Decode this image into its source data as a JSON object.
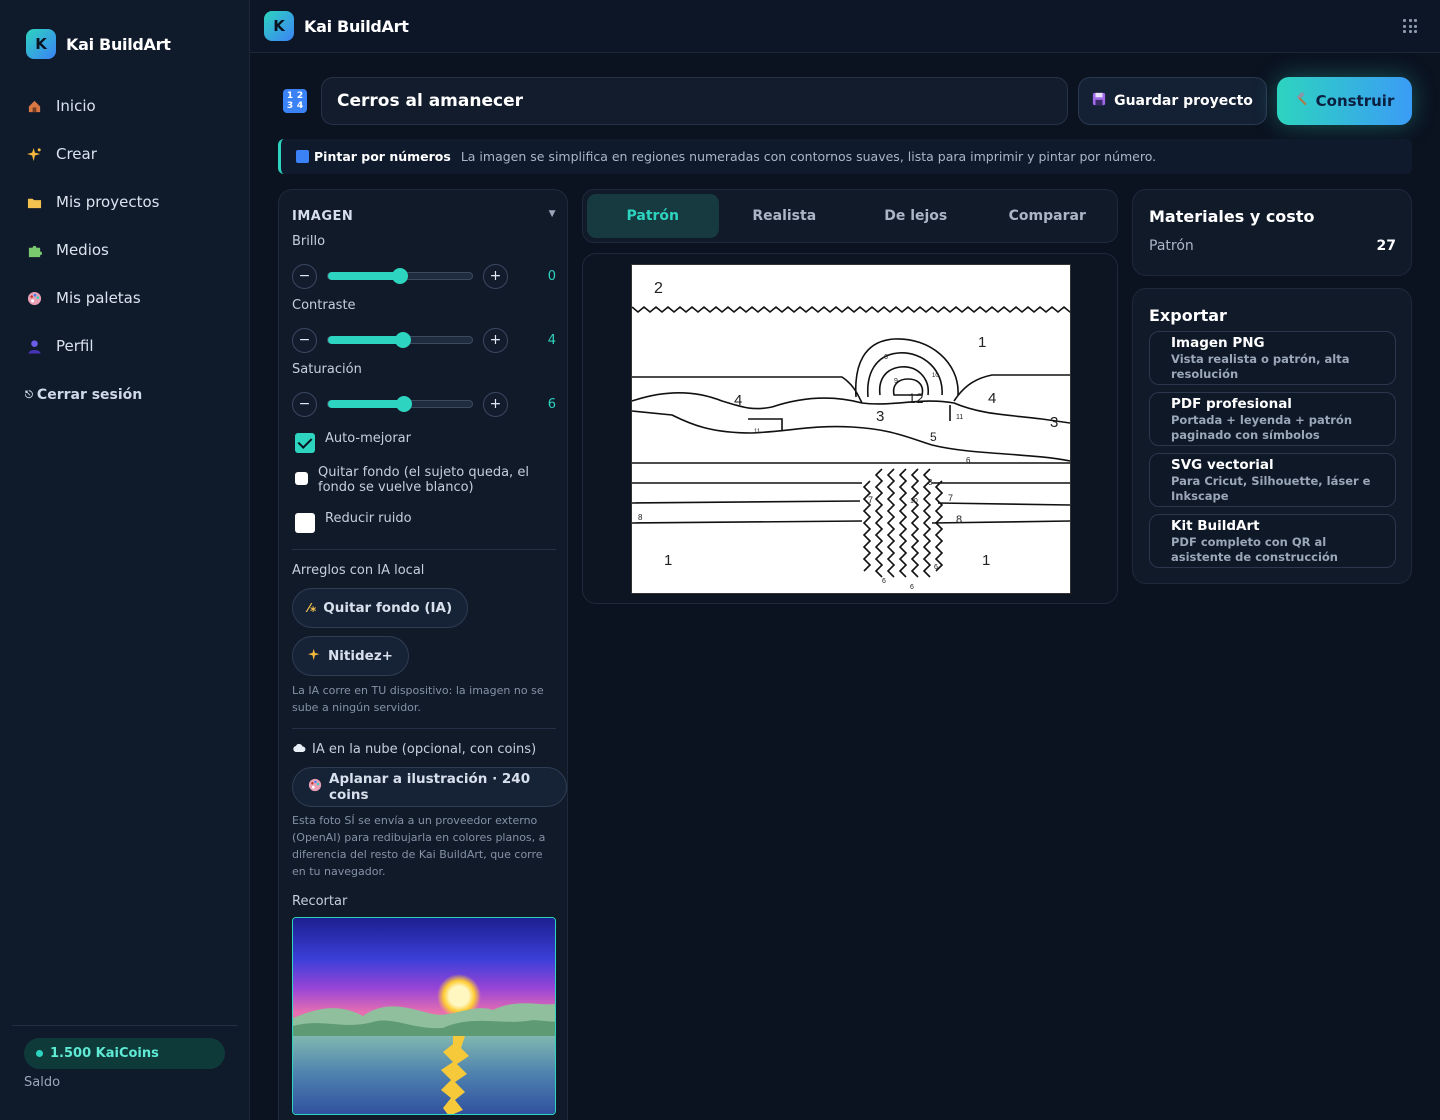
{
  "app": {
    "name": "Kai BuildArt",
    "logo_letter": "K"
  },
  "sidebar": {
    "items": [
      {
        "label": "Inicio",
        "icon": "house-icon"
      },
      {
        "label": "Crear",
        "icon": "sparkles-icon"
      },
      {
        "label": "Mis proyectos",
        "icon": "folder-icon"
      },
      {
        "label": "Medios",
        "icon": "puzzle-icon"
      },
      {
        "label": "Mis paletas",
        "icon": "palette-icon"
      },
      {
        "label": "Perfil",
        "icon": "person-icon"
      }
    ],
    "logout": "Cerrar sesión",
    "coins": "1.500 KaiCoins",
    "balance_label": "Saldo"
  },
  "project": {
    "title": "Cerros al amanecer",
    "save_label": "Guardar proyecto",
    "build_label": "Construir"
  },
  "banner": {
    "title": "Pintar por números",
    "text": "La imagen se simplifica en regiones numeradas con contornos suaves, lista para imprimir y pintar por número."
  },
  "image_panel": {
    "heading": "IMAGEN",
    "sliders": [
      {
        "label": "Brillo",
        "value": "0",
        "fraction": 0.5
      },
      {
        "label": "Contraste",
        "value": "4",
        "fraction": 0.52
      },
      {
        "label": "Saturación",
        "value": "6",
        "fraction": 0.53
      }
    ],
    "checks": [
      {
        "label": "Auto-mejorar",
        "checked": true
      },
      {
        "label": "Quitar fondo (el sujeto queda, el fondo se vuelve blanco)",
        "checked": false
      },
      {
        "label": "Reducir ruido",
        "checked": false
      }
    ],
    "local_ai": {
      "heading": "Arreglos con IA local",
      "remove_bg": "Quitar fondo (IA)",
      "sharpen": "Nitidez+",
      "note": "La IA corre en TU dispositivo: la imagen no se sube a ningún servidor."
    },
    "cloud_ai": {
      "heading": "IA en la nube (opcional, con coins)",
      "flatten": "Aplanar a ilustración · 240 coins",
      "note": "Esta foto SÍ se envía a un proveedor externo (OpenAI) para redibujarla en colores planos, a diferencia del resto de Kai BuildArt, que corre en tu navegador."
    },
    "crop_label": "Recortar"
  },
  "tabs": [
    {
      "label": "Patrón",
      "active": true
    },
    {
      "label": "Realista",
      "active": false
    },
    {
      "label": "De lejos",
      "active": false
    },
    {
      "label": "Comparar",
      "active": false
    }
  ],
  "materials": {
    "title": "Materiales y costo",
    "row_label": "Patrón",
    "row_value": "27"
  },
  "export": {
    "title": "Exportar",
    "options": [
      {
        "title": "Imagen PNG",
        "desc": "Vista realista o patrón, alta resolución"
      },
      {
        "title": "PDF profesional",
        "desc": "Portada + leyenda + patrón paginado con símbolos"
      },
      {
        "title": "SVG vectorial",
        "desc": "Para Cricut, Silhouette, láser e Inkscape"
      },
      {
        "title": "Kit BuildArt",
        "desc": "PDF completo con QR al asistente de construcción"
      }
    ]
  },
  "pattern_numbers": [
    "2",
    "1",
    "4",
    "3",
    "12",
    "4",
    "3",
    "5",
    "6",
    "1",
    "1",
    "7",
    "7",
    "8",
    "8",
    "3",
    "11",
    "11",
    "6",
    "9",
    "10",
    "10",
    "6",
    "6",
    "6",
    "8"
  ],
  "colors": {
    "accent": "#2dd4bf",
    "accent2": "#3b82f6",
    "bg": "#0b1220"
  }
}
